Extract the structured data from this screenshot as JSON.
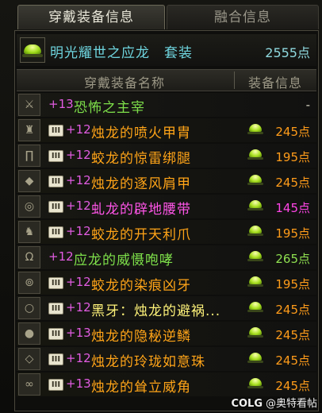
{
  "tabs": [
    {
      "label": "穿戴装备信息",
      "active": true
    },
    {
      "label": "融合信息",
      "active": false
    }
  ],
  "set": {
    "icon": "green-dome-gem-icon",
    "name": "明光耀世之应龙　套装",
    "points": "2555点"
  },
  "columns": {
    "name": "穿戴装备名称",
    "info": "装备信息"
  },
  "items": [
    {
      "slot_icon": "sword-icon",
      "glyph": "⚔",
      "badge": false,
      "enhance": "+13",
      "name": "恐怖之主宰",
      "name_color": "green",
      "gem": false,
      "points": "-",
      "points_color": "dash"
    },
    {
      "slot_icon": "chest-armor-icon",
      "glyph": "♜",
      "badge": true,
      "badge_text": "III",
      "enhance": "+12",
      "name": "烛龙的喷火甲胄",
      "name_color": "orange",
      "gem": true,
      "points": "245点",
      "points_color": "orange"
    },
    {
      "slot_icon": "pants-icon",
      "glyph": "∏",
      "badge": true,
      "badge_text": "III",
      "enhance": "+12",
      "name": "蛟龙的惊雷绑腿",
      "name_color": "orange",
      "gem": true,
      "points": "195点",
      "points_color": "orange"
    },
    {
      "slot_icon": "shoulder-icon",
      "glyph": "◆",
      "badge": true,
      "badge_text": "III",
      "enhance": "+12",
      "name": "烛龙的逐风肩甲",
      "name_color": "orange",
      "gem": true,
      "points": "245点",
      "points_color": "orange"
    },
    {
      "slot_icon": "belt-icon",
      "glyph": "◎",
      "badge": true,
      "badge_text": "III",
      "enhance": "+12",
      "name": "虬龙的辟地腰带",
      "name_color": "pink",
      "gem": true,
      "points": "145点",
      "points_color": "pink"
    },
    {
      "slot_icon": "boots-icon",
      "glyph": "♞",
      "badge": true,
      "badge_text": "III",
      "enhance": "+12",
      "name": "蛟龙的开天利爪",
      "name_color": "orange",
      "gem": true,
      "points": "195点",
      "points_color": "orange"
    },
    {
      "slot_icon": "necklace-icon",
      "glyph": "Ω",
      "badge": false,
      "enhance": "+12",
      "name": "应龙的威慑咆哮",
      "name_color": "green",
      "gem": true,
      "points": "265点",
      "points_color": "green"
    },
    {
      "slot_icon": "bracelet-icon",
      "glyph": "⊚",
      "badge": true,
      "badge_text": "III",
      "enhance": "+12",
      "name": "蛟龙的染痕凶牙",
      "name_color": "orange",
      "gem": true,
      "points": "195点",
      "points_color": "orange"
    },
    {
      "slot_icon": "ring-icon",
      "glyph": "○",
      "badge": true,
      "badge_text": "III",
      "enhance": "+12",
      "name": "黑牙：烛龙的避祸...",
      "name_color": "white",
      "gem": true,
      "points": "245点",
      "points_color": "orange"
    },
    {
      "slot_icon": "subweapon-icon",
      "glyph": "●",
      "badge": true,
      "badge_text": "III",
      "enhance": "+13",
      "name": "烛龙的隐秘逆鳞",
      "name_color": "orange",
      "gem": true,
      "points": "245点",
      "points_color": "orange"
    },
    {
      "slot_icon": "gem-jewel-icon",
      "glyph": "◇",
      "badge": true,
      "badge_text": "III",
      "enhance": "+12",
      "name": "烛龙的玲珑如意珠",
      "name_color": "orange",
      "gem": true,
      "points": "245点",
      "points_color": "orange"
    },
    {
      "slot_icon": "earring-icon",
      "glyph": "∞",
      "badge": true,
      "badge_text": "III",
      "enhance": "+13",
      "name": "烛龙的耸立威角",
      "name_color": "orange",
      "gem": true,
      "points": "245点",
      "points_color": "orange"
    }
  ],
  "watermark": {
    "logo": "COLG",
    "text": "@奥特看帖"
  }
}
